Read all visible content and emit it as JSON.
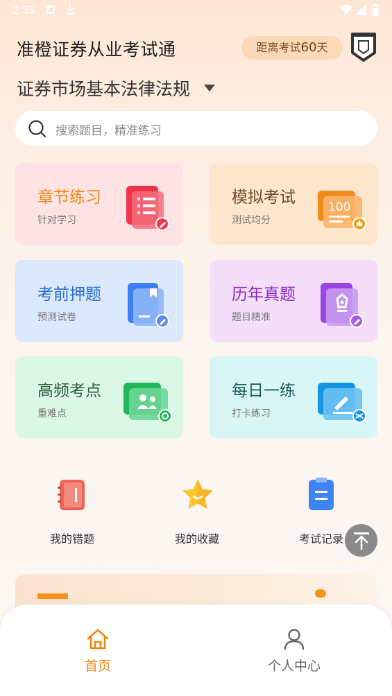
{
  "status_bar": {
    "time": "2:35"
  },
  "header": {
    "title": "准橙证券从业考试通",
    "countdown_prefix": "距离考试",
    "countdown_days": "60",
    "countdown_suffix": "天"
  },
  "subject": {
    "label": "证券市场基本法律法规"
  },
  "search": {
    "placeholder": "搜索题目，精准练习"
  },
  "cards": [
    {
      "title": "章节练习",
      "subtitle": "针对学习",
      "title_color": "#f0860f",
      "bg": "#fde3e3",
      "icon": "chapter-practice-icon"
    },
    {
      "title": "模拟考试",
      "subtitle": "测试均分",
      "title_color": "#6b4a2a",
      "bg": "#fde6cc",
      "icon": "mock-exam-icon"
    },
    {
      "title": "考前押题",
      "subtitle": "预测试卷",
      "title_color": "#2a6fd1",
      "bg": "#dce8fb",
      "icon": "pre-exam-icon"
    },
    {
      "title": "历年真题",
      "subtitle": "题目精准",
      "title_color": "#8a2bc9",
      "bg": "#f5def9",
      "icon": "past-papers-icon"
    },
    {
      "title": "高频考点",
      "subtitle": "重难点",
      "title_color": "#2b5e3a",
      "bg": "#dbf7e6",
      "icon": "key-points-icon"
    },
    {
      "title": "每日一练",
      "subtitle": "打卡练习",
      "title_color": "#1f5a5a",
      "bg": "#d8f6f6",
      "icon": "daily-practice-icon"
    }
  ],
  "quick_links": [
    {
      "label": "我的错题",
      "icon": "notebook-icon"
    },
    {
      "label": "我的收藏",
      "icon": "star-icon"
    },
    {
      "label": "考试记录",
      "icon": "clipboard-icon"
    }
  ],
  "bottom_nav": [
    {
      "label": "首页",
      "icon": "home-icon",
      "active": true
    },
    {
      "label": "个人中心",
      "icon": "user-icon",
      "active": false
    }
  ],
  "colors": {
    "accent": "#f0860f",
    "inactive": "#666666"
  }
}
